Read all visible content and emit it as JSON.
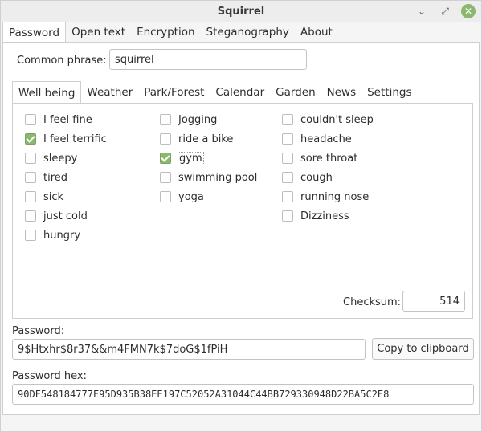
{
  "window": {
    "title": "Squirrel"
  },
  "main_tabs": [
    "Password",
    "Open text",
    "Encryption",
    "Steganography",
    "About"
  ],
  "common_phrase": {
    "label": "Common phrase:",
    "value": "squirrel"
  },
  "sub_tabs": [
    "Well being",
    "Weather",
    "Park/Forest",
    "Calendar",
    "Garden",
    "News",
    "Settings"
  ],
  "wellbeing": {
    "col1": [
      {
        "label": "I feel fine",
        "checked": false
      },
      {
        "label": "I feel terrific",
        "checked": true
      },
      {
        "label": "sleepy",
        "checked": false
      },
      {
        "label": "tired",
        "checked": false
      },
      {
        "label": "sick",
        "checked": false
      },
      {
        "label": "just cold",
        "checked": false
      },
      {
        "label": "hungry",
        "checked": false
      }
    ],
    "col2": [
      {
        "label": "Jogging",
        "checked": false
      },
      {
        "label": "ride a bike",
        "checked": false
      },
      {
        "label": "gym",
        "checked": true
      },
      {
        "label": "swimming pool",
        "checked": false
      },
      {
        "label": "yoga",
        "checked": false
      }
    ],
    "col3": [
      {
        "label": "couldn't sleep",
        "checked": false
      },
      {
        "label": "headache",
        "checked": false
      },
      {
        "label": "sore throat",
        "checked": false
      },
      {
        "label": "cough",
        "checked": false
      },
      {
        "label": "running nose",
        "checked": false
      },
      {
        "label": "Dizziness",
        "checked": false
      }
    ]
  },
  "checksum": {
    "label": "Checksum:",
    "value": "514"
  },
  "password": {
    "label": "Password:",
    "value": "9$Htxhr$8r37&&m4FMN7k$7doG$1fPiH",
    "copy_label": "Copy to clipboard"
  },
  "password_hex": {
    "label": "Password hex:",
    "value": "90DF548184777F95D935B38EE197C52052A31044C44BB729330948D22BA5C2E8"
  },
  "colors": {
    "accent": "#8ab86e"
  },
  "icons": {
    "minimize": "minimize-icon",
    "maximize": "maximize-icon",
    "close": "close-icon"
  }
}
